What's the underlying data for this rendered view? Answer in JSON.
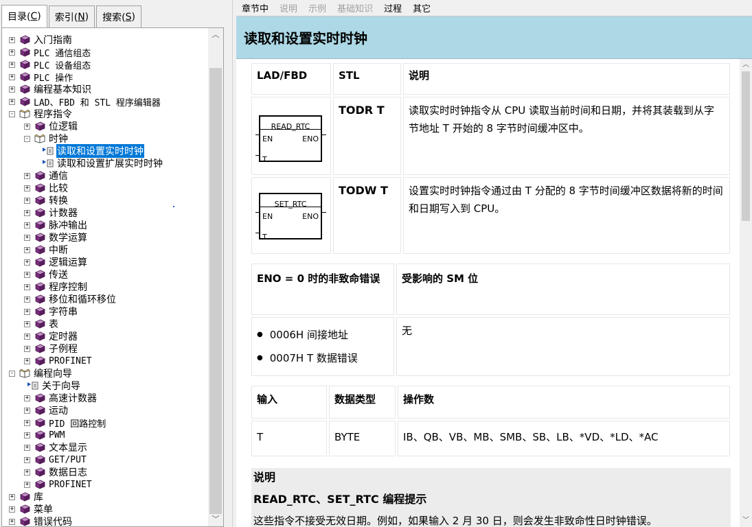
{
  "left_tabs": [
    {
      "label": "目录(C)",
      "prefix": "目录(",
      "hot": "C",
      "suffix": ")"
    },
    {
      "label": "索引(N)",
      "prefix": "索引(",
      "hot": "N",
      "suffix": ")"
    },
    {
      "label": "搜索(S)",
      "prefix": "搜索(",
      "hot": "S",
      "suffix": ")"
    }
  ],
  "tree": [
    {
      "label": "入门指南",
      "level": 0,
      "exp": "+",
      "icon": "book-closed-icon"
    },
    {
      "label": "PLC 通信组态",
      "level": 0,
      "exp": "+",
      "icon": "book-closed-icon",
      "mono": true
    },
    {
      "label": "PLC 设备组态",
      "level": 0,
      "exp": "+",
      "icon": "book-closed-icon",
      "mono": true
    },
    {
      "label": "PLC 操作",
      "level": 0,
      "exp": "+",
      "icon": "book-closed-icon",
      "mono": true
    },
    {
      "label": "编程基本知识",
      "level": 0,
      "exp": "+",
      "icon": "book-closed-icon"
    },
    {
      "label": "LAD、FBD 和 STL 程序编辑器",
      "level": 0,
      "exp": "+",
      "icon": "book-closed-icon",
      "mono": true
    },
    {
      "label": "程序指令",
      "level": 0,
      "exp": "-",
      "icon": "book-open-icon"
    },
    {
      "label": "位逻辑",
      "level": 1,
      "exp": "+",
      "icon": "book-closed-icon"
    },
    {
      "label": "时钟",
      "level": 1,
      "exp": "-",
      "icon": "book-open-icon"
    },
    {
      "label": "读取和设置实时时钟",
      "level": 2,
      "exp": "",
      "icon": "topic-page-icon",
      "selected": true
    },
    {
      "label": "读取和设置扩展实时时钟",
      "level": 2,
      "exp": "",
      "icon": "topic-page-icon"
    },
    {
      "label": "通信",
      "level": 1,
      "exp": "+",
      "icon": "book-closed-icon"
    },
    {
      "label": "比较",
      "level": 1,
      "exp": "+",
      "icon": "book-closed-icon"
    },
    {
      "label": "转换",
      "level": 1,
      "exp": "+",
      "icon": "book-closed-icon"
    },
    {
      "label": "计数器",
      "level": 1,
      "exp": "+",
      "icon": "book-closed-icon"
    },
    {
      "label": "脉冲输出",
      "level": 1,
      "exp": "+",
      "icon": "book-closed-icon"
    },
    {
      "label": "数学运算",
      "level": 1,
      "exp": "+",
      "icon": "book-closed-icon"
    },
    {
      "label": "中断",
      "level": 1,
      "exp": "+",
      "icon": "book-closed-icon"
    },
    {
      "label": "逻辑运算",
      "level": 1,
      "exp": "+",
      "icon": "book-closed-icon"
    },
    {
      "label": "传送",
      "level": 1,
      "exp": "+",
      "icon": "book-closed-icon"
    },
    {
      "label": "程序控制",
      "level": 1,
      "exp": "+",
      "icon": "book-closed-icon"
    },
    {
      "label": "移位和循环移位",
      "level": 1,
      "exp": "+",
      "icon": "book-closed-icon"
    },
    {
      "label": "字符串",
      "level": 1,
      "exp": "+",
      "icon": "book-closed-icon"
    },
    {
      "label": "表",
      "level": 1,
      "exp": "+",
      "icon": "book-closed-icon"
    },
    {
      "label": "定时器",
      "level": 1,
      "exp": "+",
      "icon": "book-closed-icon"
    },
    {
      "label": "子例程",
      "level": 1,
      "exp": "+",
      "icon": "book-closed-icon"
    },
    {
      "label": "PROFINET",
      "level": 1,
      "exp": "+",
      "icon": "book-closed-icon",
      "mono": true
    },
    {
      "label": "编程向导",
      "level": 0,
      "exp": "-",
      "icon": "book-open-icon"
    },
    {
      "label": "关于向导",
      "level": 1,
      "exp": "",
      "icon": "topic-page-icon"
    },
    {
      "label": "高速计数器",
      "level": 1,
      "exp": "+",
      "icon": "book-closed-icon"
    },
    {
      "label": "运动",
      "level": 1,
      "exp": "+",
      "icon": "book-closed-icon"
    },
    {
      "label": "PID 回路控制",
      "level": 1,
      "exp": "+",
      "icon": "book-closed-icon",
      "mono": true
    },
    {
      "label": "PWM",
      "level": 1,
      "exp": "+",
      "icon": "book-closed-icon",
      "mono": true
    },
    {
      "label": "文本显示",
      "level": 1,
      "exp": "+",
      "icon": "book-closed-icon"
    },
    {
      "label": "GET/PUT",
      "level": 1,
      "exp": "+",
      "icon": "book-closed-icon",
      "mono": true
    },
    {
      "label": "数据日志",
      "level": 1,
      "exp": "+",
      "icon": "book-closed-icon"
    },
    {
      "label": "PROFINET",
      "level": 1,
      "exp": "+",
      "icon": "book-closed-icon",
      "mono": true
    },
    {
      "label": "库",
      "level": 0,
      "exp": "+",
      "icon": "book-closed-icon"
    },
    {
      "label": "菜单",
      "level": 0,
      "exp": "+",
      "icon": "book-closed-icon"
    },
    {
      "label": "错误代码",
      "level": 0,
      "exp": "+",
      "icon": "book-closed-icon"
    }
  ],
  "topnav": [
    {
      "label": "章节中",
      "enabled": true
    },
    {
      "label": "说明",
      "enabled": false
    },
    {
      "label": "示例",
      "enabled": false
    },
    {
      "label": "基础知识",
      "enabled": false
    },
    {
      "label": "过程",
      "enabled": true
    },
    {
      "label": "其它",
      "enabled": true
    }
  ],
  "page_title": "读取和设置实时时钟",
  "instr_table": {
    "headers": [
      "LAD/FBD",
      "STL",
      "说明"
    ],
    "rows": [
      {
        "box_name": "READ_RTC",
        "en": "EN",
        "eno": "ENO",
        "t": "T",
        "stl": "TODR  T",
        "desc": "读取实时时钟指令从 CPU 读取当前时间和日期，并将其装载到从字节地址 T 开始的 8 字节时间缓冲区中。"
      },
      {
        "box_name": "SET_RTC",
        "en": "EN",
        "eno": "ENO",
        "t": "T",
        "stl": "TODW  T",
        "desc": "设置实时时钟指令通过由 T 分配的 8 字节时间缓冲区数据将新的时间和日期写入到 CPU。"
      }
    ]
  },
  "error_table": {
    "h1": "ENO = 0 时的非致命错误",
    "h2": "受影响的 SM 位",
    "errors": [
      "0006H 间接地址",
      "0007H T 数据错误"
    ],
    "bullet": "●",
    "sm": "无"
  },
  "operand_table": {
    "headers": [
      "输入",
      "数据类型",
      "操作数"
    ],
    "row": [
      "T",
      "BYTE",
      "IB、QB、VB、MB、SMB、SB、LB、*VD、*LD、*AC"
    ]
  },
  "description": {
    "heading": "说明",
    "subheading": "READ_RTC、SET_RTC 编程提示",
    "text": "这些指令不接受无效日期。例如，如果输入 2 月 30 日，则会发生非致命性日时钟错误。"
  },
  "scroll_glyphs": {
    "up": "︿",
    "down": "﹀"
  },
  "colors": {
    "title_bg": "#add8e6",
    "selection": "#0078d7",
    "book": "#7a2e7f"
  }
}
